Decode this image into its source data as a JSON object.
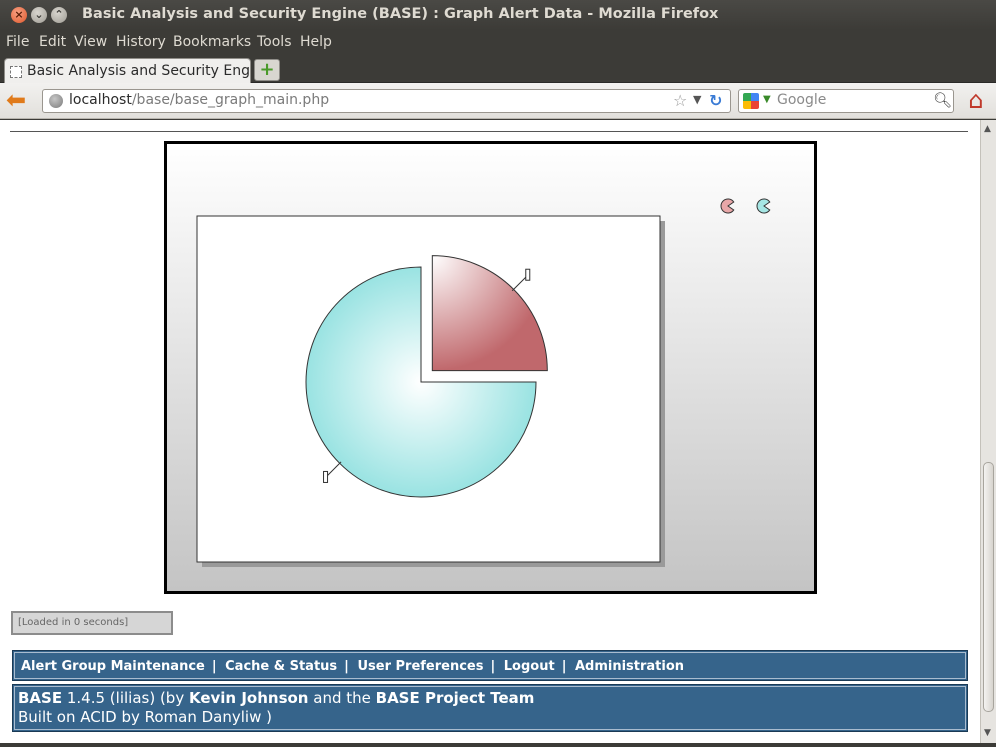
{
  "window": {
    "title": "Basic Analysis and Security Engine (BASE) : Graph Alert Data - Mozilla Firefox"
  },
  "menu": {
    "items": [
      "File",
      "Edit",
      "View",
      "History",
      "Bookmarks",
      "Tools",
      "Help"
    ]
  },
  "tabs": [
    {
      "label": "Basic Analysis and Security Eng..."
    }
  ],
  "nav": {
    "url_host": "localhost",
    "url_path": "/base/base_graph_main.php",
    "search_placeholder": "Google"
  },
  "chart_data": {
    "type": "pie",
    "title": "",
    "slices": [
      {
        "value": 75,
        "color": "#8fe0df"
      },
      {
        "value": 25,
        "color": "#c0686c"
      }
    ],
    "legend": {
      "placement": "top-right",
      "colors": [
        "#e8a7a8",
        "#a6e6e4"
      ]
    },
    "slice_labels": [
      "",
      ""
    ]
  },
  "status": {
    "loaded_text": "[Loaded in 0 seconds]"
  },
  "footer_nav": {
    "links": [
      "Alert Group Maintenance",
      "Cache & Status",
      "User Preferences",
      "Logout",
      "Administration"
    ]
  },
  "footer": {
    "product": "BASE",
    "version": " 1.4.5 (lilias) (by ",
    "author": "Kevin Johnson",
    "and_text": " and the ",
    "team": "BASE Project Team",
    "built_on": "Built on ACID by Roman Danyliw )"
  },
  "colors": {
    "accent": "#36648b"
  }
}
